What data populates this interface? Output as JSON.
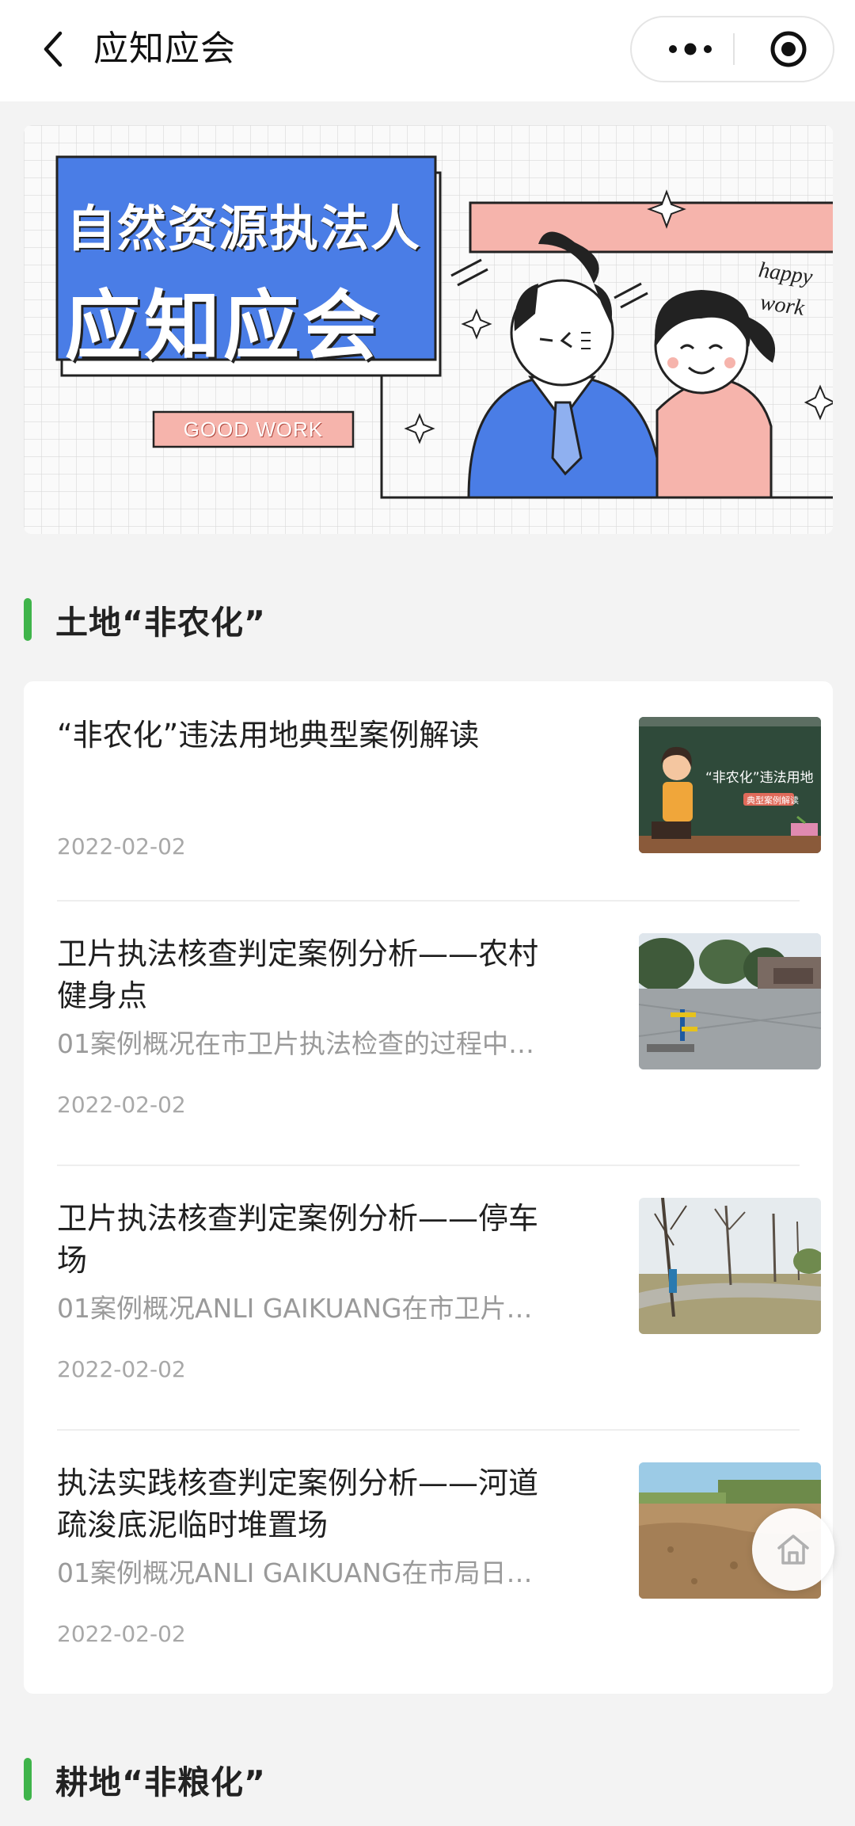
{
  "app": {
    "title": "应知应会"
  },
  "banner": {
    "headline_line1": "自然资源执法人",
    "headline_line2": "应知应会",
    "tag": "GOOD WORK",
    "doodle_line1": "happy",
    "doodle_line2": "work"
  },
  "sections": [
    {
      "title": "土地“非农化”"
    },
    {
      "title": "耕地“非粮化”"
    }
  ],
  "articles": [
    {
      "title": "“非农化”违法用地典型案例解读",
      "desc": "",
      "date": "2022-02-02",
      "thumb_icon": "classroom-illustration",
      "thumb_caption": "“非农化”违法用地",
      "thumb_subcaption": "典型案例解读"
    },
    {
      "title": "卫片执法核查判定案例分析——农村健身点",
      "desc": "01案例概况在市卫片执法检查的过程中…",
      "date": "2022-02-02",
      "thumb_icon": "fitness-plaza-photo"
    },
    {
      "title": "卫片执法核查判定案例分析——停车场",
      "desc": "01案例概况ANLI GAIKUANG在市卫片…",
      "date": "2022-02-02",
      "thumb_icon": "tree-lot-photo"
    },
    {
      "title": "执法实践核查判定案例分析——河道疏浚底泥临时堆置场",
      "desc": "01案例概况ANLI GAIKUANG在市局日…",
      "date": "2022-02-02",
      "thumb_icon": "soil-field-photo"
    }
  ],
  "icons": {
    "back": "chevron-left-icon",
    "more": "more-dots-icon",
    "close_target": "target-icon",
    "home": "home-icon"
  },
  "colors": {
    "accent_green": "#3fb44a",
    "banner_blue": "#4a7de6",
    "banner_pink": "#f6b4ac"
  }
}
